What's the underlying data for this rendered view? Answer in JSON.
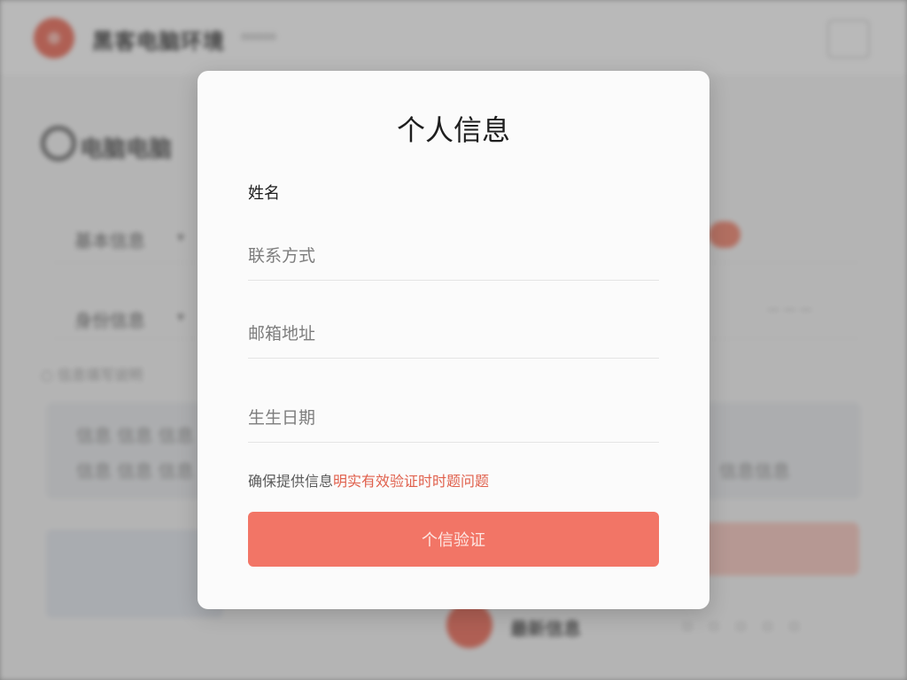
{
  "background_app": {
    "title": "黑客电脑环境",
    "subtitle": "ooooo",
    "search_text": "电脑电脑",
    "row1_label": "基本信息",
    "row2_label": "身份信息",
    "row_chevron": "▾",
    "row2_right": "— — —",
    "note": "○ 信息填写说明",
    "card_line1": "信息 信息 信息",
    "card_line2": "信息 信息 信息",
    "card_right": "信息信息",
    "footer_text": "最新信息",
    "footer_icons": "▫▫▫▫▫"
  },
  "modal": {
    "title": "个人信息",
    "name_label": "姓名",
    "fields": [
      {
        "placeholder": "联系方式",
        "value": ""
      },
      {
        "placeholder": "邮箱地址",
        "value": ""
      },
      {
        "placeholder": "生生日期",
        "value": ""
      }
    ],
    "notice_prefix": "确保提供信息",
    "notice_highlight": "明实有效验证时时题问题",
    "submit_label": "个信验证"
  },
  "colors": {
    "accent": "#f27566",
    "notice_highlight": "#e0604c",
    "logo": "#e8604c"
  }
}
